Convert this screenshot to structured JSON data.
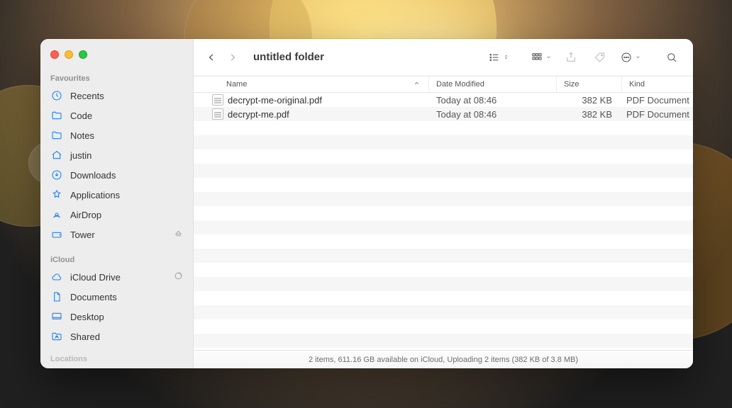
{
  "window": {
    "title": "untitled folder"
  },
  "sidebar": {
    "sections": [
      {
        "label": "Favourites",
        "items": [
          {
            "label": "Recents",
            "icon": "clock"
          },
          {
            "label": "Code",
            "icon": "folder"
          },
          {
            "label": "Notes",
            "icon": "folder"
          },
          {
            "label": "justin",
            "icon": "home"
          },
          {
            "label": "Downloads",
            "icon": "download"
          },
          {
            "label": "Applications",
            "icon": "apps"
          },
          {
            "label": "AirDrop",
            "icon": "airdrop"
          },
          {
            "label": "Tower",
            "icon": "drive",
            "trailing": "eject"
          }
        ]
      },
      {
        "label": "iCloud",
        "items": [
          {
            "label": "iCloud Drive",
            "icon": "cloud",
            "trailing": "progress"
          },
          {
            "label": "Documents",
            "icon": "doc"
          },
          {
            "label": "Desktop",
            "icon": "desktop"
          },
          {
            "label": "Shared",
            "icon": "sharedfolder"
          }
        ]
      },
      {
        "label": "Locations",
        "items": []
      }
    ]
  },
  "columns": {
    "name": "Name",
    "date": "Date Modified",
    "size": "Size",
    "kind": "Kind"
  },
  "files": [
    {
      "name": "decrypt-me-original.pdf",
      "date": "Today at 08:46",
      "size": "382 KB",
      "kind": "PDF Document"
    },
    {
      "name": "decrypt-me.pdf",
      "date": "Today at 08:46",
      "size": "382 KB",
      "kind": "PDF Document"
    }
  ],
  "status": "2 items, 611.16 GB available on iCloud, Uploading 2 items (382 KB of 3.8 MB)"
}
